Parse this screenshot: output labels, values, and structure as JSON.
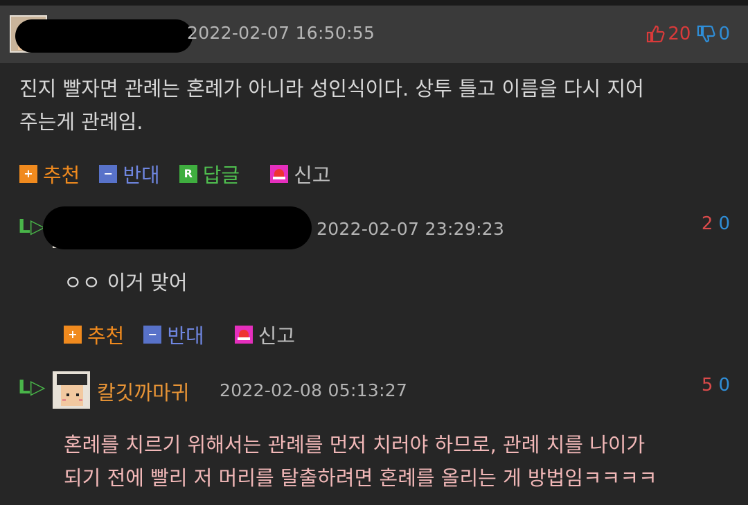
{
  "comment": {
    "timestamp": "2022-02-07 16:50:55",
    "up_votes": "20",
    "down_votes": "0",
    "text_line1": "진지 빨자면 관례는 혼례가 아니라 성인식이다. 상투 틀고 이름을 다시 지어",
    "text_line2": "주는게 관례임.",
    "actions": {
      "recommend": "추천",
      "oppose": "반대",
      "reply": "답글",
      "report": "신고"
    },
    "reply_icon_letter": "R"
  },
  "reply1": {
    "timestamp": "2022-02-07 23:29:23",
    "up_votes": "2",
    "down_votes": "0",
    "text": "ㅇㅇ 이거 맞어",
    "actions": {
      "recommend": "추천",
      "oppose": "반대",
      "report": "신고"
    }
  },
  "reply2": {
    "nickname": "칼깃까마귀",
    "timestamp": "2022-02-08 05:13:27",
    "up_votes": "5",
    "down_votes": "0",
    "text_line1": "혼례를 치르기 위해서는 관례를 먼저 치러야 하므로, 관례 치를 나이가",
    "text_line2": "되기 전에 빨리 저 머리를 탈출하려면 혼례를 올리는 게 방법임ㅋㅋㅋㅋ"
  },
  "icons": {
    "plus_symbol": "+",
    "minus_symbol": "−",
    "reply_arrow": "L▷"
  },
  "colors": {
    "background": "#262626",
    "header": "#3a3a3a",
    "accent_orange": "#f08a1e",
    "accent_blue": "#6f86e0",
    "accent_green": "#4fbf4f",
    "vote_up": "#d93a3a",
    "vote_down": "#2f8ed8"
  }
}
